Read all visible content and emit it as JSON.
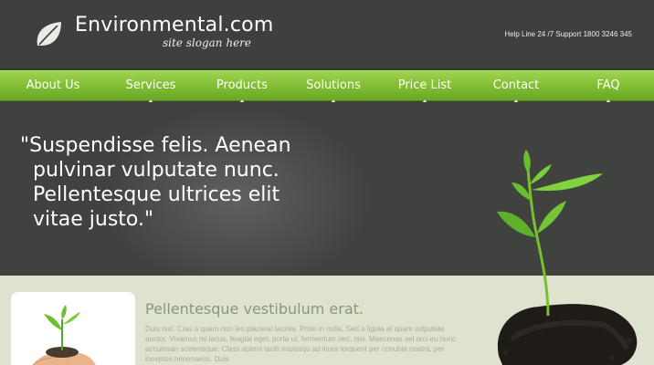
{
  "header": {
    "brand": "Environmental.com",
    "slogan": "site slogan here",
    "helpline": "Help Line 24 /7 Support 1800 3246 345",
    "logo_icon": "leaf-icon"
  },
  "nav": {
    "items": [
      {
        "label": "About Us"
      },
      {
        "label": "Services"
      },
      {
        "label": "Products"
      },
      {
        "label": "Solutions"
      },
      {
        "label": "Price List"
      },
      {
        "label": "Contact"
      },
      {
        "label": "FAQ"
      }
    ],
    "color": "#8cc63f"
  },
  "hero": {
    "quote_lines": [
      "\"Suspendisse felis. Aenean",
      "pulvinar vulputate nunc.",
      "Pellentesque ultrices elit",
      "vitae justo.\""
    ]
  },
  "content": {
    "title": "Pellentesque vestibulum erat.",
    "body": "Duis nisl. Cras a quam non leo placerat lacinia. Proin in nulla. Sed a ligula at quam vulputate auctor. Vivamus mi lacus, feugiat eget, porta ut, fermentum nec, nisi. Maecenas vel orci eu nunc accumsan scelerisque. Class aptent taciti sociosqu ad litora torquent per conubia nostra, per inceptos himenaeos. Duis"
  }
}
